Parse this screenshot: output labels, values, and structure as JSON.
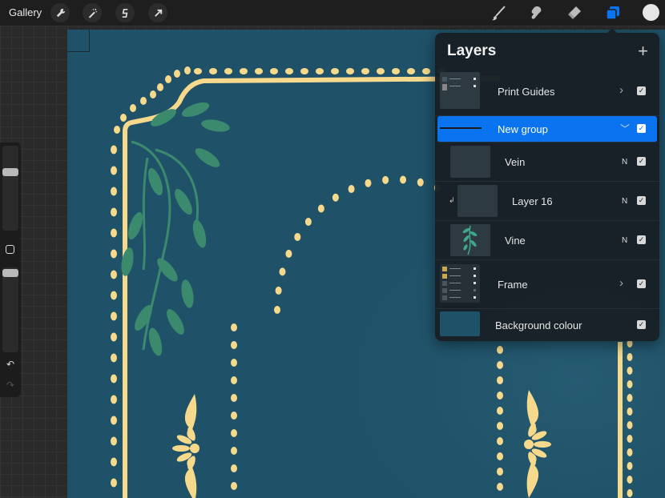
{
  "topbar": {
    "gallery_label": "Gallery",
    "left_tools": [
      {
        "name": "actions",
        "icon": "wrench-icon"
      },
      {
        "name": "adjustments",
        "icon": "magic-wand-icon"
      },
      {
        "name": "selection",
        "icon": "selection-s-icon"
      },
      {
        "name": "transform",
        "icon": "arrow-cursor-icon"
      }
    ],
    "right_tools": [
      {
        "name": "brush",
        "icon": "brush-icon",
        "active": false
      },
      {
        "name": "smudge",
        "icon": "smudge-finger-icon",
        "active": false
      },
      {
        "name": "eraser",
        "icon": "eraser-icon",
        "active": false
      },
      {
        "name": "layers",
        "icon": "layers-icon",
        "active": true
      }
    ],
    "current_color": "#e6e6e6",
    "accent_color": "#0a74f0"
  },
  "sidebar": {
    "brush_size": 0.85,
    "opacity": 0.98,
    "modify_icon": "square-modify-icon",
    "undo_icon": "undo-icon",
    "redo_icon": "redo-icon"
  },
  "canvas": {
    "background_color": "#1f5268",
    "frame_color": "#f7d98c",
    "vine_color": "#3b8a6e"
  },
  "layers_panel": {
    "title": "Layers",
    "add_icon": "plus-icon",
    "layers": [
      {
        "name": "Print Guides",
        "type": "group",
        "expanded": false,
        "visible": true,
        "selected": false,
        "blend": ""
      },
      {
        "name": "New group",
        "type": "group",
        "expanded": true,
        "visible": true,
        "selected": true,
        "blend": ""
      },
      {
        "name": "Vein",
        "type": "layer",
        "visible": true,
        "selected": false,
        "blend": "N",
        "indent": true
      },
      {
        "name": "Layer 16",
        "type": "layer",
        "visible": true,
        "selected": false,
        "blend": "N",
        "indent": true,
        "clipping": true
      },
      {
        "name": "Vine",
        "type": "layer",
        "visible": true,
        "selected": false,
        "blend": "N",
        "indent": true
      },
      {
        "name": "Frame",
        "type": "group",
        "expanded": false,
        "visible": true,
        "selected": false,
        "blend": ""
      },
      {
        "name": "Background colour",
        "type": "background",
        "visible": true,
        "selected": false,
        "blend": "",
        "color": "#1f5268"
      }
    ]
  }
}
